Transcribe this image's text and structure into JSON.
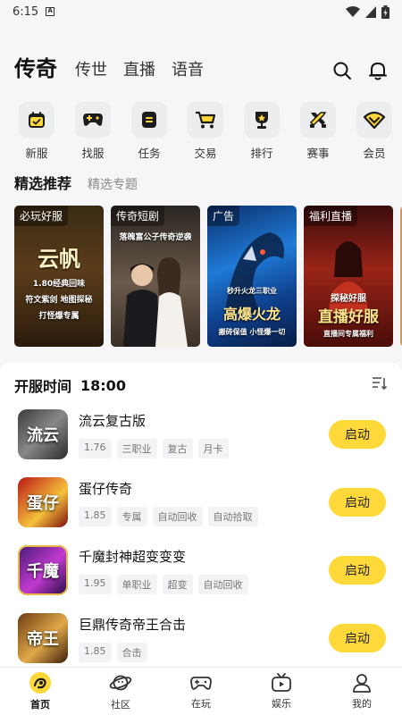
{
  "status_bar": {
    "time": "6:15",
    "notif_glyph": "A"
  },
  "header": {
    "tabs": [
      {
        "label": "传奇",
        "active": true
      },
      {
        "label": "传世",
        "active": false
      },
      {
        "label": "直播",
        "active": false
      },
      {
        "label": "语音",
        "active": false
      }
    ],
    "icons": [
      "search-icon",
      "bell-icon"
    ]
  },
  "categories": [
    {
      "label": "新服",
      "icon": "calendar-icon"
    },
    {
      "label": "找服",
      "icon": "gamepad-icon"
    },
    {
      "label": "任务",
      "icon": "task-icon"
    },
    {
      "label": "交易",
      "icon": "cart-icon"
    },
    {
      "label": "排行",
      "icon": "trophy-icon"
    },
    {
      "label": "赛事",
      "icon": "swords-icon"
    },
    {
      "label": "会员",
      "icon": "vip-icon"
    }
  ],
  "section_tabs": {
    "active": "精选推荐",
    "other": "精选专题"
  },
  "banners": [
    {
      "tag": "必玩好服",
      "caption_main": "云帆",
      "caption_lines": [
        "1.80经典回味",
        "符文紫剑 地图探秘",
        "打怪爆专属"
      ]
    },
    {
      "tag": "传奇短剧",
      "caption_main": "落魄富公子传奇逆袭",
      "caption_lines": []
    },
    {
      "tag": "广告",
      "caption_main": "高爆火龙",
      "caption_lines": [
        "秒升火龙三职业",
        "搬砖保值 小怪爆一切"
      ]
    },
    {
      "tag": "福利直播",
      "caption_main": "直播好服",
      "caption_lines": [
        "探秘好服",
        "直播间专属福利"
      ]
    }
  ],
  "server_list": {
    "title": "开服时间",
    "time": "18:00",
    "games": [
      {
        "name": "流云复古版",
        "icon_text": "流云",
        "tags": [
          "1.76",
          "三职业",
          "复古",
          "月卡"
        ],
        "button": "启动"
      },
      {
        "name": "蛋仔传奇",
        "icon_text": "蛋仔",
        "tags": [
          "1.85",
          "专属",
          "自动回收",
          "自动拾取"
        ],
        "button": "启动"
      },
      {
        "name": "千魔封神超变变变",
        "icon_text": "千魔",
        "tags": [
          "1.95",
          "单职业",
          "超变",
          "自动回收"
        ],
        "button": "启动"
      },
      {
        "name": "巨鼎传奇帝王合击",
        "icon_text": "帝王",
        "tags": [
          "1.85",
          "合击"
        ],
        "button": "启动"
      }
    ]
  },
  "bottom_nav": [
    {
      "label": "首页",
      "icon": "home-icon",
      "active": true
    },
    {
      "label": "社区",
      "icon": "planet-icon",
      "active": false
    },
    {
      "label": "在玩",
      "icon": "gamepad-icon",
      "active": false
    },
    {
      "label": "娱乐",
      "icon": "tv-icon",
      "active": false
    },
    {
      "label": "我的",
      "icon": "profile-icon",
      "active": false
    }
  ],
  "colors": {
    "accent": "#ffd83a",
    "background": "#f6f6f8",
    "tile": "#ecedef"
  }
}
